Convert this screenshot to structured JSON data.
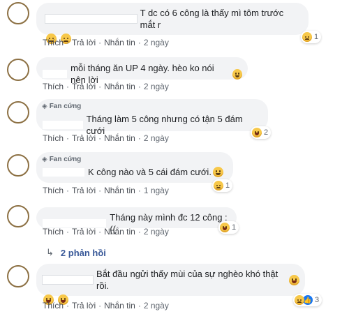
{
  "actions": {
    "like": "Thích",
    "reply": "Trả lời",
    "message": "Nhắn tin",
    "sep": "·"
  },
  "fan_badge": "Fan cứng",
  "comments": [
    {
      "text": "T dc có 6 công là thấy mì tôm trước mắt r",
      "time": "2 ngày",
      "reaction_count": "1",
      "reaction": "sad-emoji"
    },
    {
      "text": "mỗi tháng ăn UP 4 ngày. hèo ko nói nên lời",
      "time": "2 ngày",
      "reaction_count": "",
      "reaction": ""
    },
    {
      "text": "Tháng làm 5 công nhưng có tận 5 đám cưới",
      "time": "2 ngày",
      "reaction_count": "2",
      "reaction": "laugh-emoji",
      "badge": true
    },
    {
      "text": "K công nào và 5 cái đám cưới.",
      "time": "1 ngày",
      "reaction_count": "1",
      "reaction": "sad-emoji",
      "badge": true
    },
    {
      "text": "Tháng này mình đc 12 công :((",
      "time": "2 ngày",
      "reaction_count": "1",
      "reaction": "laugh-emoji"
    },
    {
      "text": "Bắt đầu ngửi thấy mùi của sự nghèo khó thật rồi.",
      "time": "2 ngày",
      "reaction_count": "3",
      "reaction": "sad-like-emoji"
    }
  ],
  "replies": {
    "label": "2 phản hồi"
  },
  "colors": {
    "bubble": "#f2f3f5",
    "link": "#385898",
    "meta": "#606770",
    "avatar_border": "#8c7043"
  }
}
